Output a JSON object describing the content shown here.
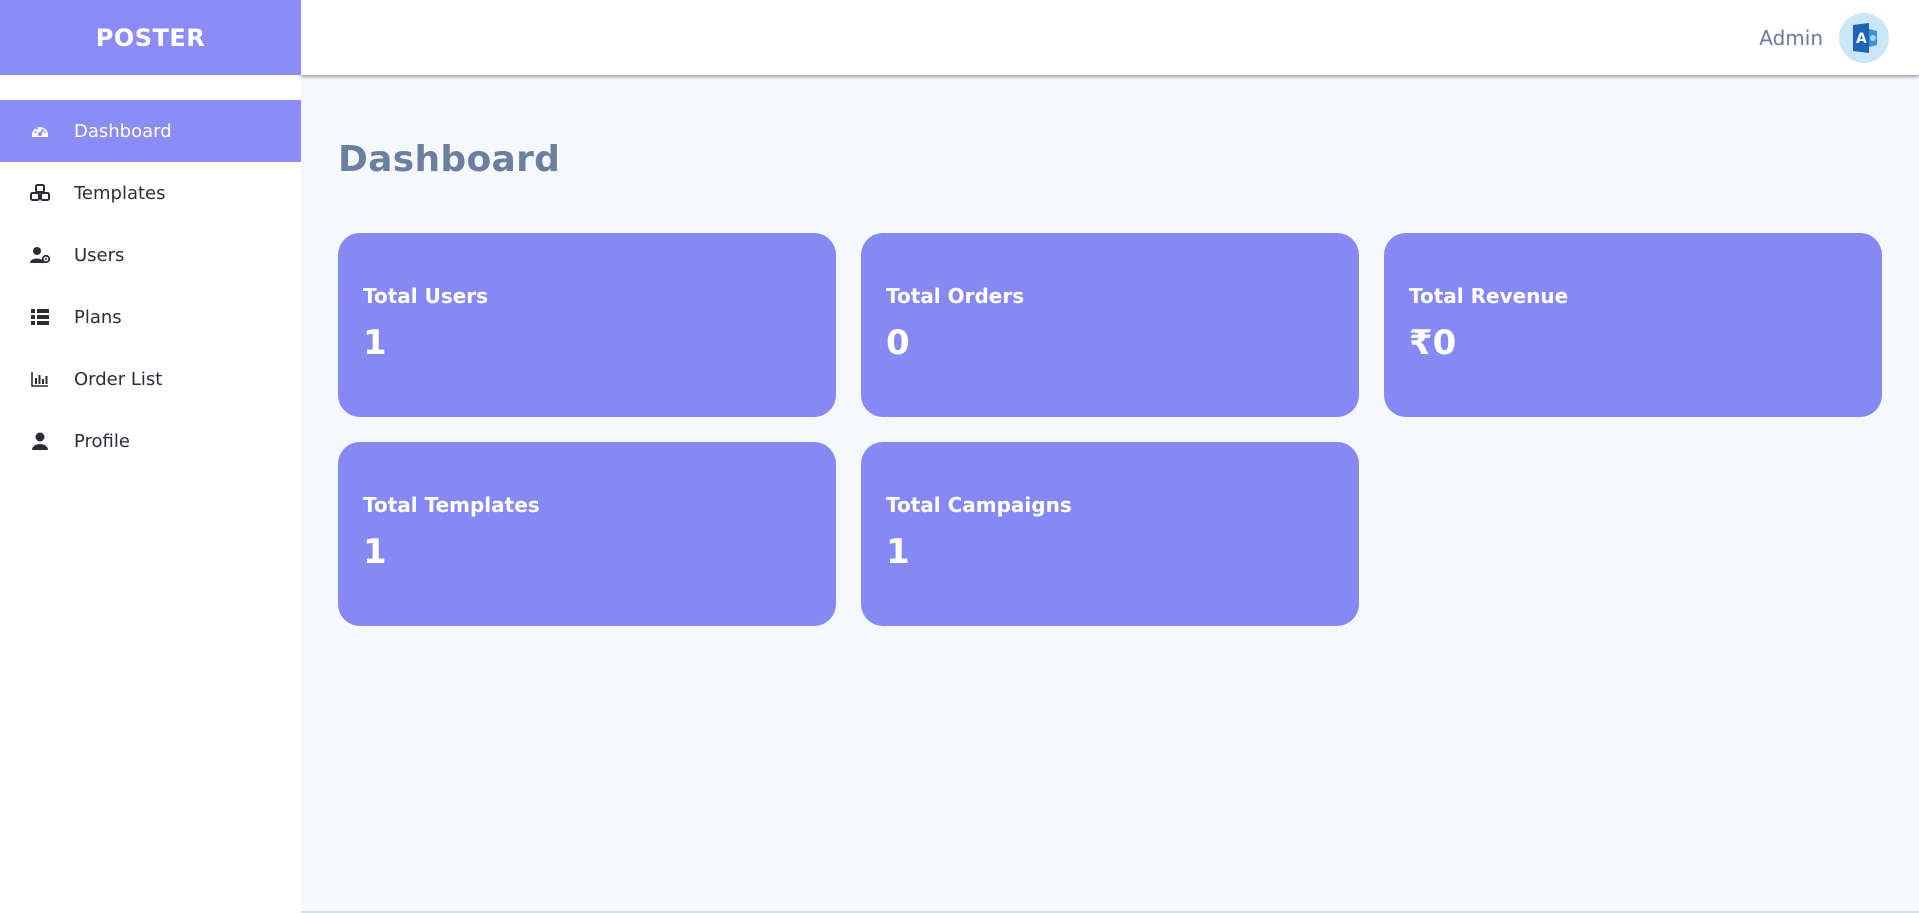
{
  "brand": {
    "name": "POSTER"
  },
  "header": {
    "user_name": "Admin",
    "avatar_letter": "A"
  },
  "sidebar": {
    "items": [
      {
        "label": "Dashboard",
        "icon": "dashboard-gauge-icon",
        "active": true
      },
      {
        "label": "Templates",
        "icon": "templates-icon",
        "active": false
      },
      {
        "label": "Users",
        "icon": "users-gear-icon",
        "active": false
      },
      {
        "label": "Plans",
        "icon": "list-icon",
        "active": false
      },
      {
        "label": "Order List",
        "icon": "bar-chart-icon",
        "active": false
      },
      {
        "label": "Profile",
        "icon": "user-icon",
        "active": false
      }
    ]
  },
  "main": {
    "title": "Dashboard",
    "cards": [
      {
        "title": "Total Users",
        "value": "1"
      },
      {
        "title": "Total Orders",
        "value": "0"
      },
      {
        "title": "Total Revenue",
        "value": "₹0"
      },
      {
        "title": "Total Templates",
        "value": "1"
      },
      {
        "title": "Total Campaigns",
        "value": "1"
      }
    ]
  },
  "colors": {
    "accent": "#8b8cf5",
    "card": "#8689f4",
    "title": "#6d7f9e",
    "background": "#f5f8fc"
  }
}
